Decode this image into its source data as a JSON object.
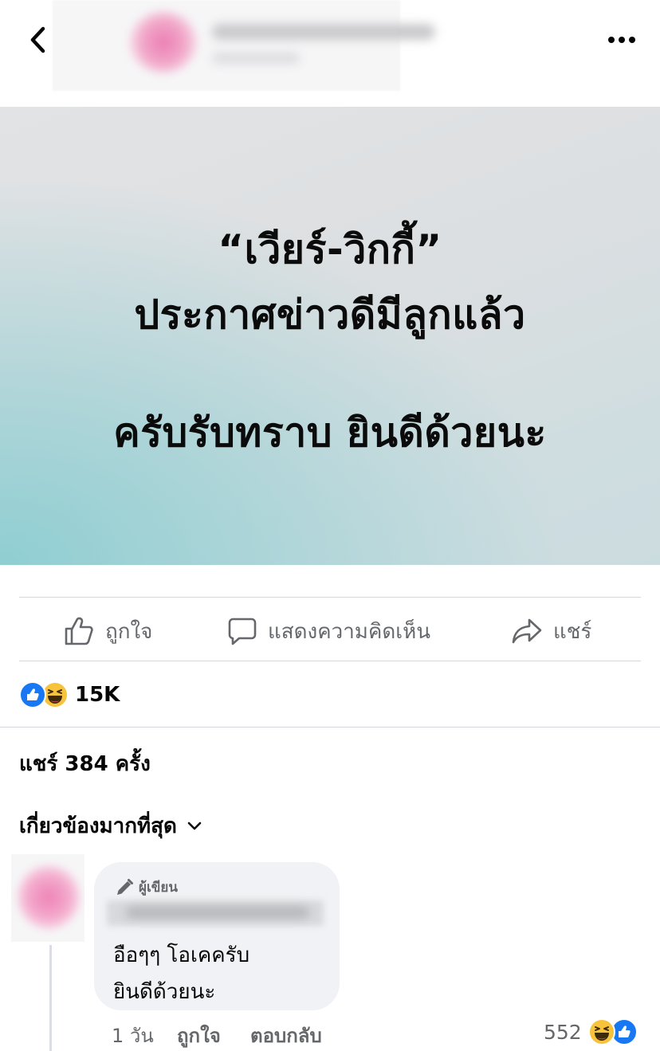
{
  "post": {
    "image_text": {
      "line1": "“เวียร์-วิกกี้”",
      "line2": "ประกาศข่าวดีมีลูกแล้ว",
      "line3": "ครับรับทราบ ยินดีด้วยนะ"
    }
  },
  "actions": {
    "like_label": "ถูกใจ",
    "comment_label": "แสดงความคิดเห็น",
    "share_label": "แชร์"
  },
  "stats": {
    "reaction_count": "15K",
    "share_text": "แชร์ 384 ครั้ง"
  },
  "comments": {
    "sort_label": "เกี่ยวข้องมากที่สุด",
    "items": [
      {
        "author_badge": "ผู้เขียน",
        "line1": "อือๆๆ โอเคครับ",
        "line2": "ยินดีด้วยนะ",
        "time": "1 วัน",
        "like_label": "ถูกใจ",
        "reply_label": "ตอบกลับ",
        "reaction_count": "552"
      }
    ]
  },
  "colors": {
    "like_blue": "#1877f2",
    "haha_yellow": "#f7c33c",
    "secondary_text": "#65676b",
    "bubble_bg": "#f0f2f5"
  },
  "icons": [
    "chevron-left-icon",
    "more-horizontal-icon",
    "thumbs-up-icon",
    "comment-icon",
    "share-arrow-icon",
    "like-reaction-icon",
    "haha-reaction-icon",
    "chevron-down-icon",
    "pencil-icon"
  ]
}
